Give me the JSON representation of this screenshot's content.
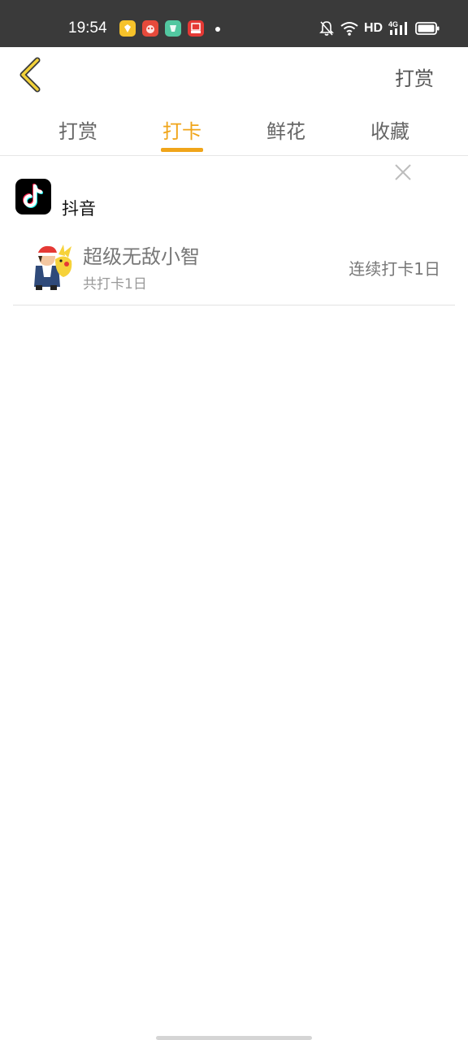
{
  "status_bar": {
    "time": "19:54",
    "network": "HD",
    "notification_icons": [
      "yellow-app-icon",
      "red-app-icon",
      "green-app-icon",
      "red-store-icon"
    ],
    "system_icons": [
      "mute-bell-icon",
      "wifi-icon",
      "4g-signal-icon",
      "battery-icon"
    ]
  },
  "nav": {
    "back_icon": "chevron-left-icon",
    "action_label": "打赏"
  },
  "tabs": [
    {
      "label": "打赏",
      "active": false
    },
    {
      "label": "打卡",
      "active": true
    },
    {
      "label": "鲜花",
      "active": false
    },
    {
      "label": "收藏",
      "active": false
    }
  ],
  "accent_color": "#f0a51a",
  "app": {
    "name": "抖音",
    "logo_icon": "tiktok-logo-icon"
  },
  "checkin_list": [
    {
      "name": "超级无敌小智",
      "total": "共打卡1日",
      "streak": "连续打卡1日"
    }
  ]
}
